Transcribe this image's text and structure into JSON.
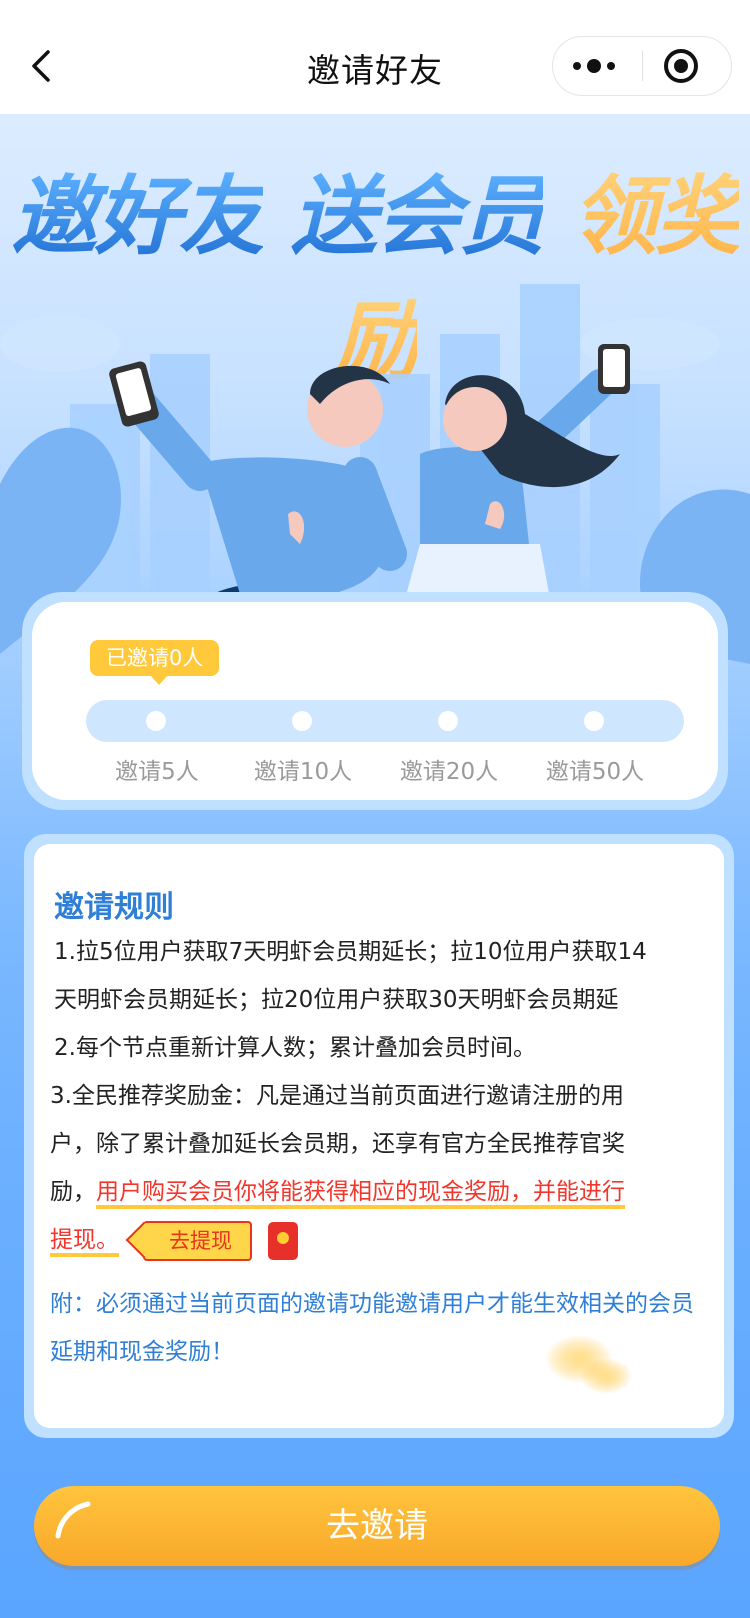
{
  "nav": {
    "title": "邀请好友"
  },
  "banner": {
    "part1": "邀好友",
    "part2": "送会员",
    "part3": "领奖励"
  },
  "progress": {
    "invited_label": "已邀请0人",
    "invited_count": 0,
    "milestones": [
      {
        "label": "邀请5人"
      },
      {
        "label": "邀请10人"
      },
      {
        "label": "邀请20人"
      },
      {
        "label": "邀请50人"
      }
    ]
  },
  "rules": {
    "title": "邀请规则",
    "line1": "1.拉5位用户获取7天明虾会员期延长；拉10位用户获取14",
    "line2": "天明虾会员期延长；拉20位用户获取30天明虾会员期延",
    "line3": "2.每个节点重新计算人数；累计叠加会员时间。",
    "line4": "3.全民推荐奖励金：凡是通过当前页面进行邀请注册的用",
    "line5": "户，除了累计叠加延长会员期，还享有官方全民推荐官奖",
    "line6_prefix": "励，",
    "line6_highlight1": "用户购买会员你将能获得相应的现金奖励",
    "line6_comma": "，",
    "line6_highlight2": "并能进行",
    "line7_highlight": "提现。",
    "withdraw_button": "去提现",
    "note": "附：必须通过当前页面的邀请功能邀请用户才能生效相关的会员延期和现金奖励！"
  },
  "cta": {
    "label": "去邀请"
  },
  "colors": {
    "accent_blue": "#2f7fd7",
    "highlight_red": "#f2362c",
    "gold": "#ffc93b",
    "cta_orange": "#f9a82a"
  },
  "icons": {
    "back": "chevron-left-icon",
    "more": "more-dots-icon",
    "close": "target-circle-icon",
    "red_packet": "red-packet-icon"
  }
}
